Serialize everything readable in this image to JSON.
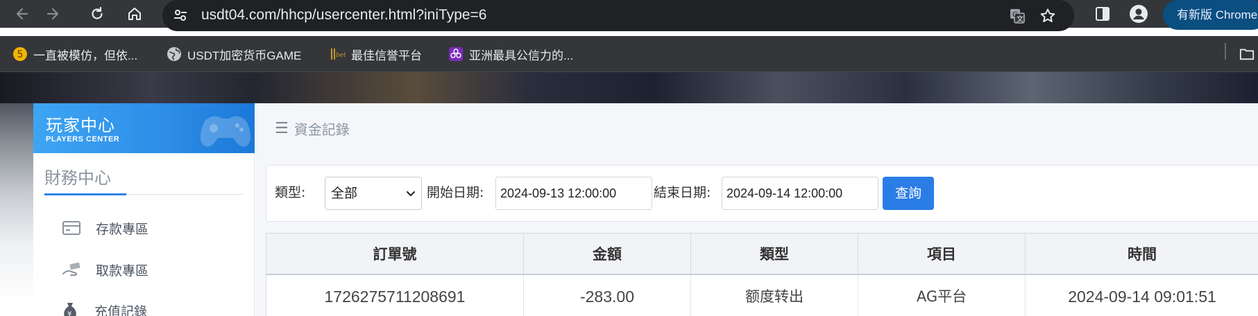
{
  "browser": {
    "url": "usdt04.com/hhcp/usercenter.html?iniType=6",
    "update_label": "有新版 Chrome",
    "bookmarks": [
      {
        "label": "一直被模仿，但依...",
        "icon": "number-five-coin-icon"
      },
      {
        "label": "USDT加密货币GAME",
        "icon": "globe-icon"
      },
      {
        "label": "最佳信誉平台",
        "icon": "gold-logo-icon"
      },
      {
        "label": "亚洲最具公信力的...",
        "icon": "purple-flower-icon"
      }
    ]
  },
  "sidebar": {
    "logo_cn": "玩家中心",
    "logo_en": "PLAYERS CENTER",
    "section_title": "財務中心",
    "items": [
      {
        "label": "存款專區",
        "icon": "card-icon"
      },
      {
        "label": "取款專區",
        "icon": "hand-money-icon"
      },
      {
        "label": "充值記錄",
        "icon": "money-bag-icon"
      }
    ]
  },
  "main": {
    "breadcrumb": "資金記錄",
    "filter": {
      "type_label": "類型:",
      "type_value": "全部",
      "start_label": "開始日期:",
      "start_value": "2024-09-13 12:00:00",
      "end_label": "結束日期:",
      "end_value": "2024-09-14 12:00:00",
      "query_label": "查詢"
    },
    "table": {
      "headers": [
        "訂單號",
        "金額",
        "類型",
        "項目",
        "時間"
      ],
      "rows": [
        [
          "1726275711208691",
          "-283.00",
          "额度转出",
          "AG平台",
          "2024-09-14 09:01:51"
        ]
      ]
    }
  },
  "colors": {
    "accent": "#2b7de6",
    "chrome_bg": "#35363a",
    "omnibox_bg": "#202124",
    "logo_blue": "#2f8fe8",
    "update_button": "#0b4e80"
  }
}
